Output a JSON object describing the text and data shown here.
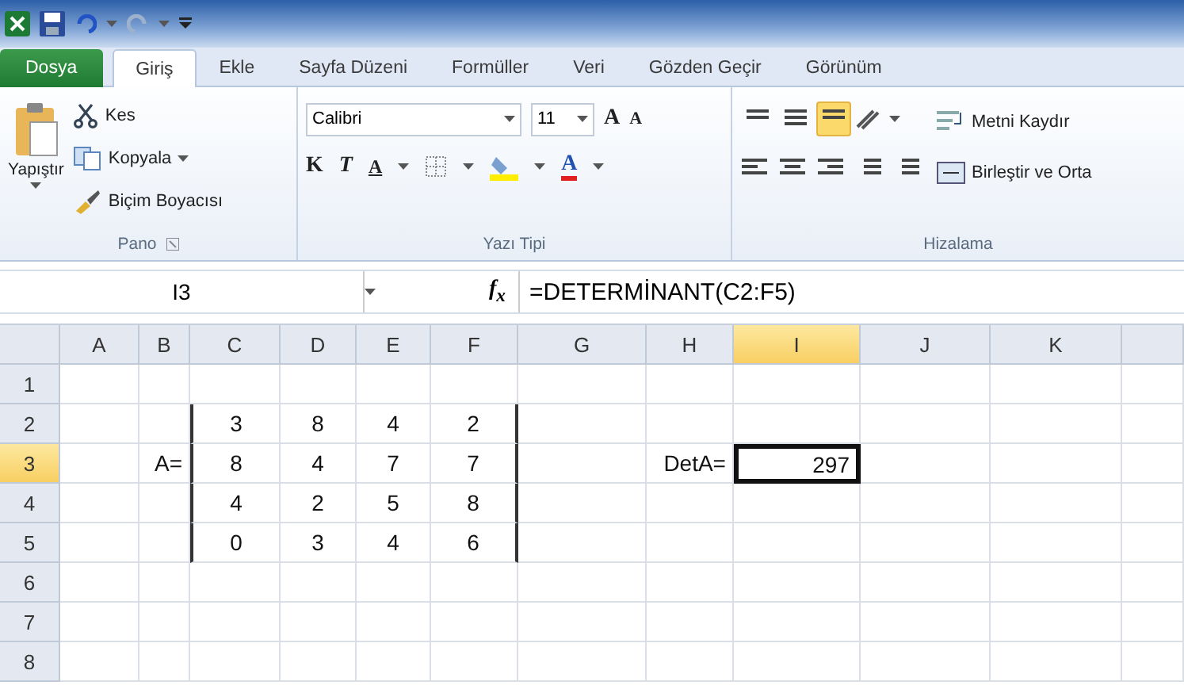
{
  "tabs": [
    {
      "label": "Dosya",
      "kind": "file",
      "selected": false
    },
    {
      "label": "Giriş",
      "kind": "tab",
      "selected": true
    },
    {
      "label": "Ekle",
      "kind": "tab",
      "selected": false
    },
    {
      "label": "Sayfa Düzeni",
      "kind": "tab",
      "selected": false
    },
    {
      "label": "Formüller",
      "kind": "tab",
      "selected": false
    },
    {
      "label": "Veri",
      "kind": "tab",
      "selected": false
    },
    {
      "label": "Gözden Geçir",
      "kind": "tab",
      "selected": false
    },
    {
      "label": "Görünüm",
      "kind": "tab",
      "selected": false
    }
  ],
  "clipboard": {
    "label": "Pano",
    "paste": "Yapıştır",
    "items": [
      "Kes",
      "Kopyala",
      "Biçim Boyacısı"
    ]
  },
  "font": {
    "label": "Yazı Tipi",
    "font_name": "Calibri",
    "font_size": "11",
    "grow": "A",
    "shrink": "A",
    "bold": "K",
    "italic": "T",
    "underline": "A",
    "font_color": "A"
  },
  "alignment": {
    "label": "Hizalama",
    "vertical": [
      {
        "selected": false
      },
      {
        "selected": false
      },
      {
        "selected": true
      }
    ],
    "wrap": "Metni Kaydır",
    "merge": "Birleştir ve Orta"
  },
  "formula_bar": {
    "name_box": "I3",
    "fx": "f$_{x}$",
    "formula": "=DETERMİNANT(C2:F5)"
  },
  "sheet": {
    "columns": [
      {
        "label": "A",
        "selected": false
      },
      {
        "label": "B",
        "selected": false
      },
      {
        "label": "C",
        "selected": false,
        "left_border": true
      },
      {
        "label": "D",
        "selected": false
      },
      {
        "label": "E",
        "selected": false
      },
      {
        "label": "F",
        "selected": false,
        "right_border": true
      },
      {
        "label": "G",
        "selected": false
      },
      {
        "label": "H",
        "selected": false
      },
      {
        "label": "I",
        "selected": true
      },
      {
        "label": "J",
        "selected": false
      },
      {
        "label": "K",
        "selected": false
      }
    ],
    "rows": [
      {
        "label": "1",
        "selected": false,
        "bracketed": false,
        "cells": [
          null,
          null,
          null,
          null,
          null,
          null,
          null,
          null,
          null,
          null,
          null
        ]
      },
      {
        "label": "2",
        "selected": false,
        "bracketed": true,
        "cells": [
          null,
          null,
          "3",
          "8",
          "4",
          "2",
          null,
          null,
          null,
          null,
          null
        ]
      },
      {
        "label": "3",
        "selected": true,
        "bracketed": true,
        "cells": [
          null,
          "A=",
          "8",
          "4",
          "7",
          "7",
          null,
          "DetA=",
          "297",
          null,
          null
        ]
      },
      {
        "label": "4",
        "selected": false,
        "bracketed": true,
        "cells": [
          null,
          null,
          "4",
          "2",
          "5",
          "8",
          null,
          null,
          null,
          null,
          null
        ]
      },
      {
        "label": "5",
        "selected": false,
        "bracketed": true,
        "cells": [
          null,
          null,
          "0",
          "3",
          "4",
          "6",
          null,
          null,
          null,
          null,
          null
        ]
      },
      {
        "label": "6",
        "selected": false,
        "bracketed": false,
        "cells": [
          null,
          null,
          null,
          null,
          null,
          null,
          null,
          null,
          null,
          null,
          null
        ]
      },
      {
        "label": "7",
        "selected": false,
        "bracketed": false,
        "cells": [
          null,
          null,
          null,
          null,
          null,
          null,
          null,
          null,
          null,
          null,
          null
        ]
      },
      {
        "label": "8",
        "selected": false,
        "bracketed": false,
        "cells": [
          null,
          null,
          null,
          null,
          null,
          null,
          null,
          null,
          null,
          null,
          null
        ]
      }
    ]
  }
}
